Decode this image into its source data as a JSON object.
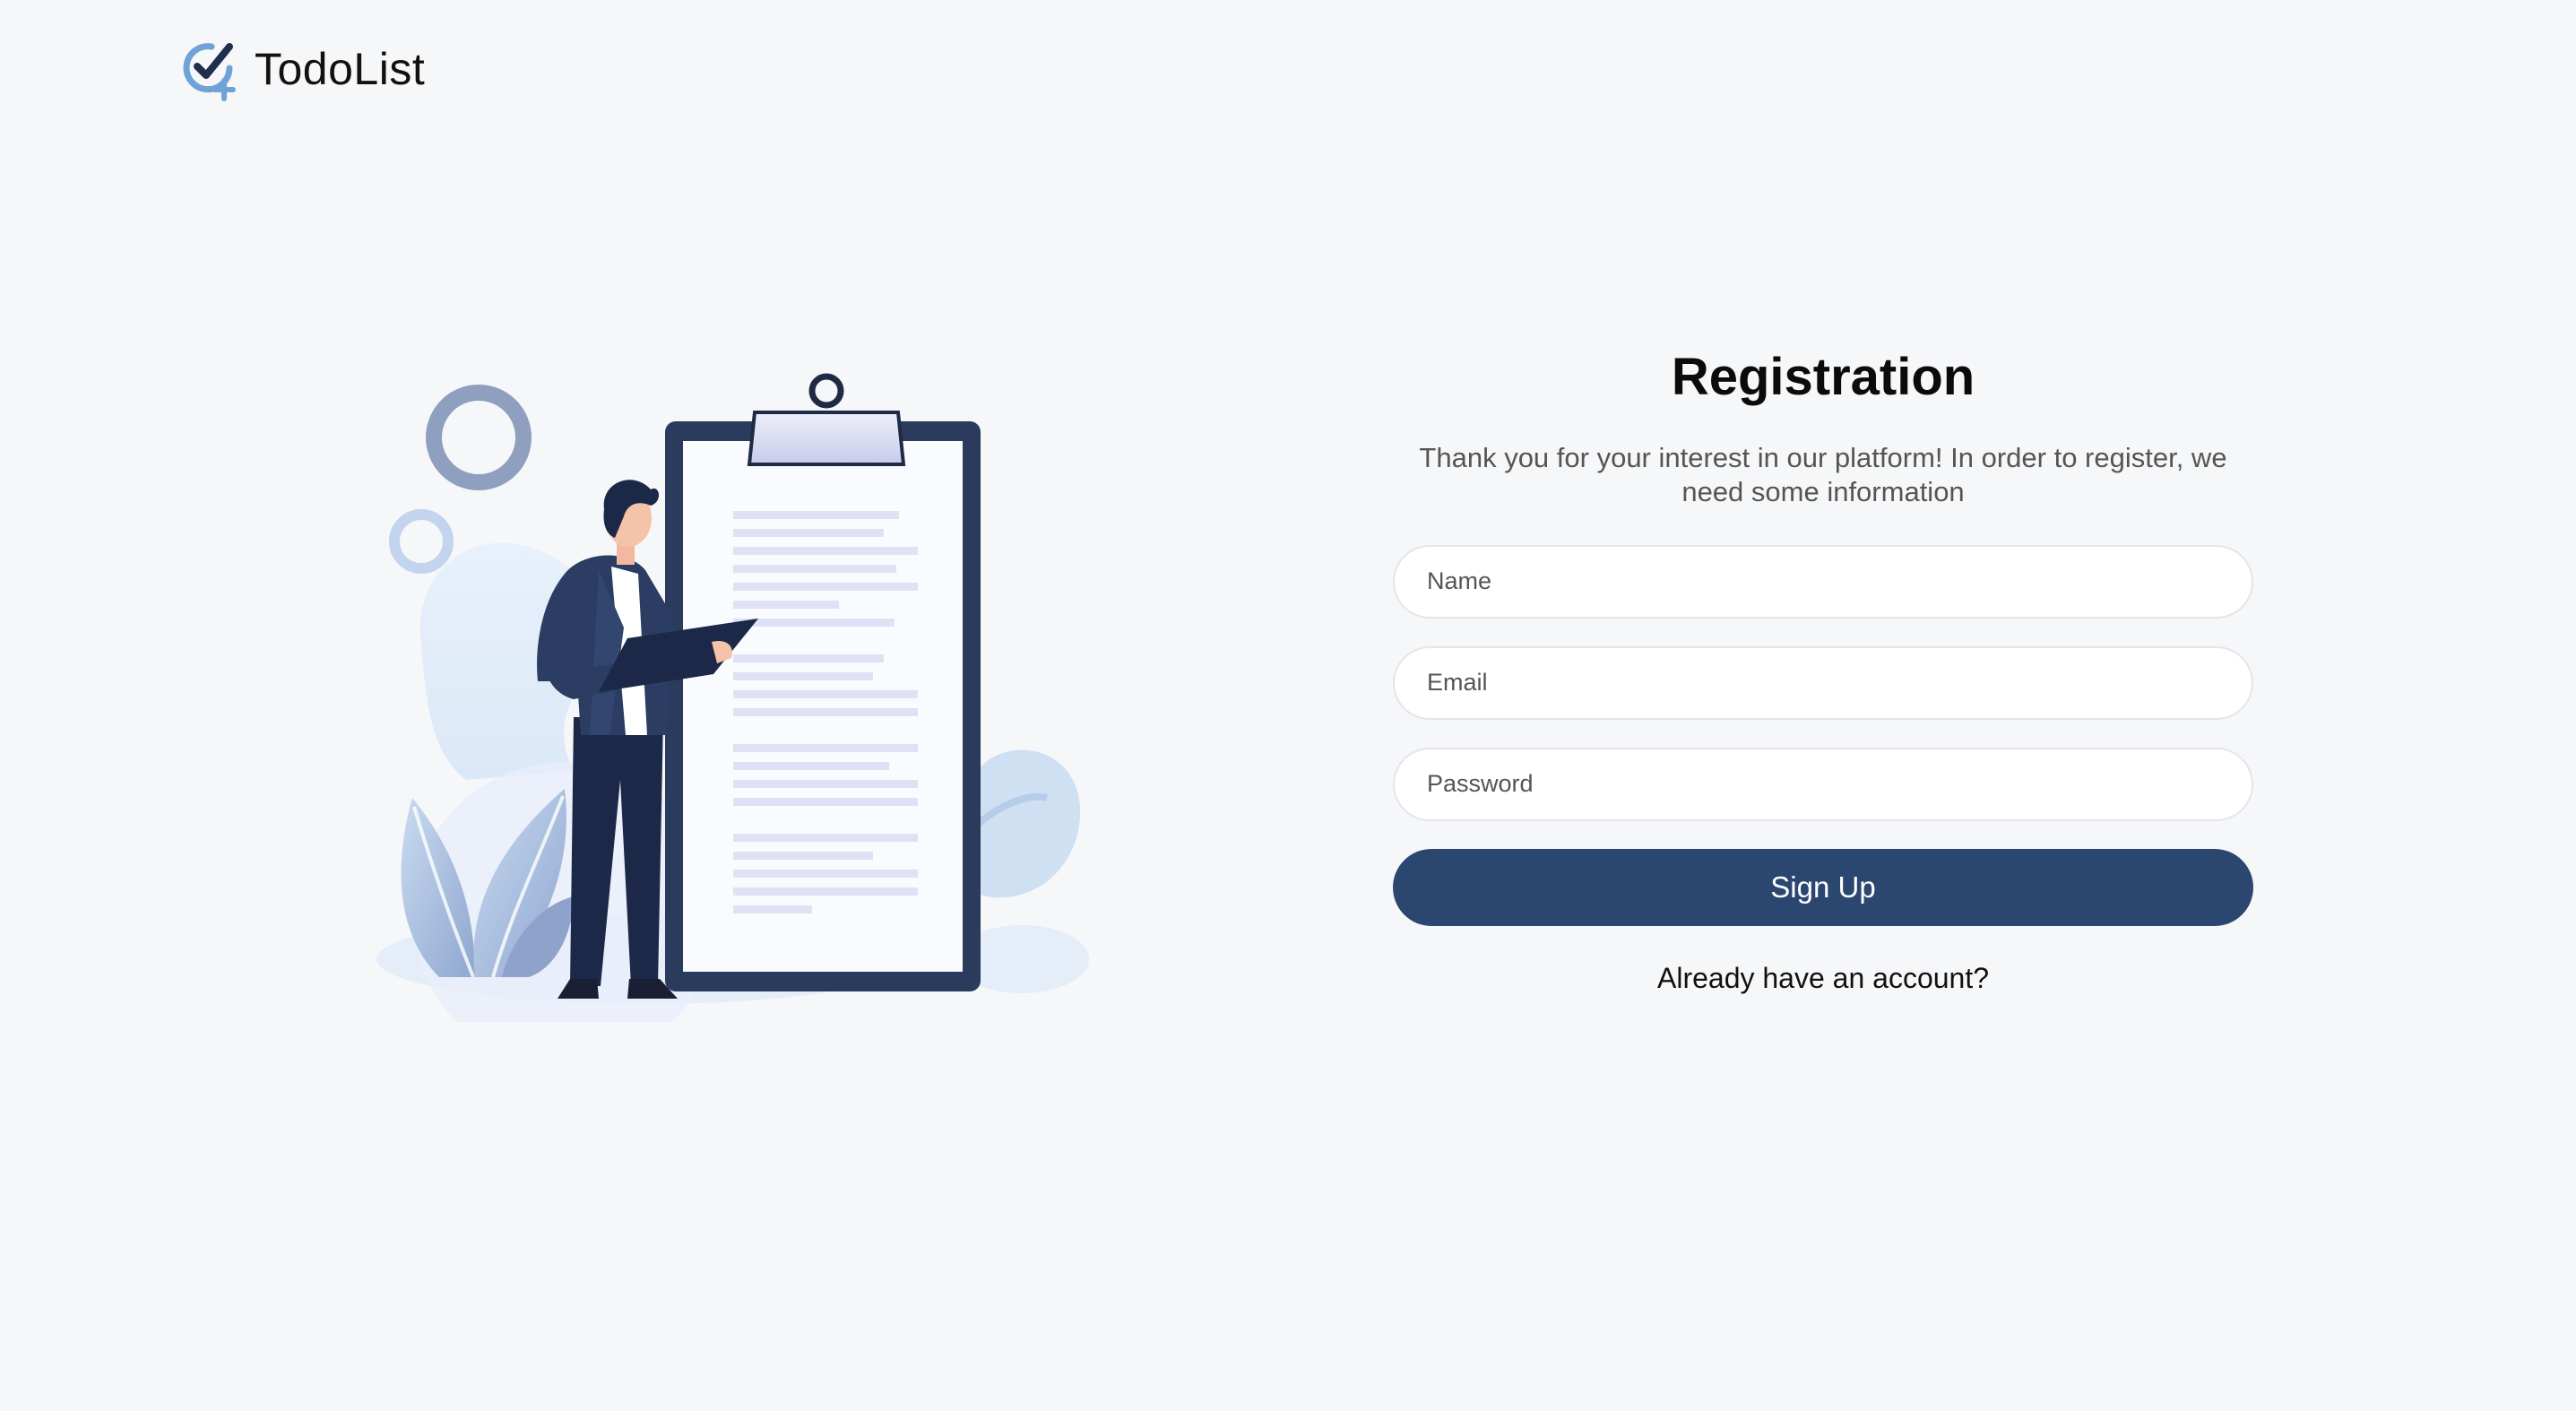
{
  "header": {
    "logo_icon": "check-circle-plus-icon",
    "app_name": "TodoList"
  },
  "illustration": {
    "icon": "person-with-clipboard-illustration"
  },
  "registration": {
    "title": "Registration",
    "subtitle": "Thank you for your interest in our platform! In order to register, we need some information",
    "name_placeholder": "Name",
    "email_placeholder": "Email",
    "password_placeholder": "Password",
    "signup_label": "Sign Up",
    "signin_link": "Already have an account?"
  },
  "colors": {
    "background": "#f6f7f9",
    "primary_button": "#2b4770",
    "logo_blue": "#6fa3d8",
    "logo_dark": "#1f2f4d"
  }
}
